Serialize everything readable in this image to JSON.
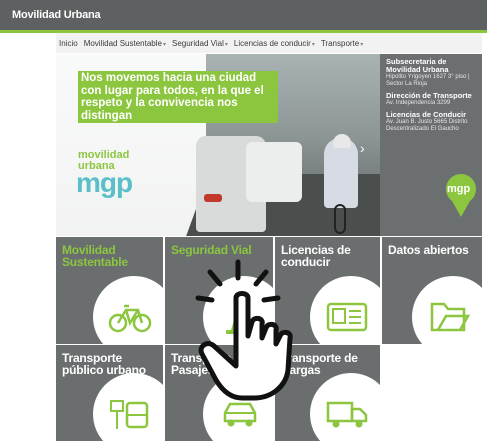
{
  "header": {
    "title": "Movilidad Urbana"
  },
  "nav": {
    "items": [
      {
        "label": "Inicio",
        "dropdown": false
      },
      {
        "label": "Movilidad Sustentable",
        "dropdown": true
      },
      {
        "label": "Seguridad Vial",
        "dropdown": true
      },
      {
        "label": "Licencias de conducir",
        "dropdown": true
      },
      {
        "label": "Transporte",
        "dropdown": true
      }
    ]
  },
  "hero": {
    "slogan": "Nos movemos hacia una ciudad con lugar para todos, en la que el respeto y la convivencia nos distingan",
    "brand_line1": "movilidad",
    "brand_line2": "urbana",
    "brand_logo": "mgp",
    "next_icon": "chevron-right-icon"
  },
  "sidebar": {
    "blocks": [
      {
        "title": "Subsecretaria de Movilidad Urbana",
        "text": "Hipolito Yrigoyen 1627 3° piso | Sector La Rioja"
      },
      {
        "title": "Dirección de Transporte",
        "text": "Av. Independencia 3299"
      },
      {
        "title": "Licencias de Conducir",
        "text": "Av. Juan B. Justo 5665 Distrito Descentralizado El Gaucho"
      }
    ],
    "logo": "mgp"
  },
  "tiles": [
    {
      "label": "Movilidad Sustentable",
      "icon": "bicycle-icon"
    },
    {
      "label": "Seguridad Vial",
      "icon": "traffic-cone-icon"
    },
    {
      "label": "Licencias de conducir",
      "icon": "id-card-icon"
    },
    {
      "label": "Datos abiertos",
      "icon": "folder-icon"
    },
    {
      "label": "Transporte público urbano",
      "icon": "bus-stop-icon"
    },
    {
      "label": "Transporte de Pasajeros",
      "icon": "car-icon"
    },
    {
      "label": "Transporte de Cargas",
      "icon": "truck-icon"
    }
  ],
  "colors": {
    "accent": "#8cc63f",
    "tile_bg": "#6a6e6f",
    "header_bg": "#5d6162",
    "brand_teal": "#5abfc8"
  }
}
